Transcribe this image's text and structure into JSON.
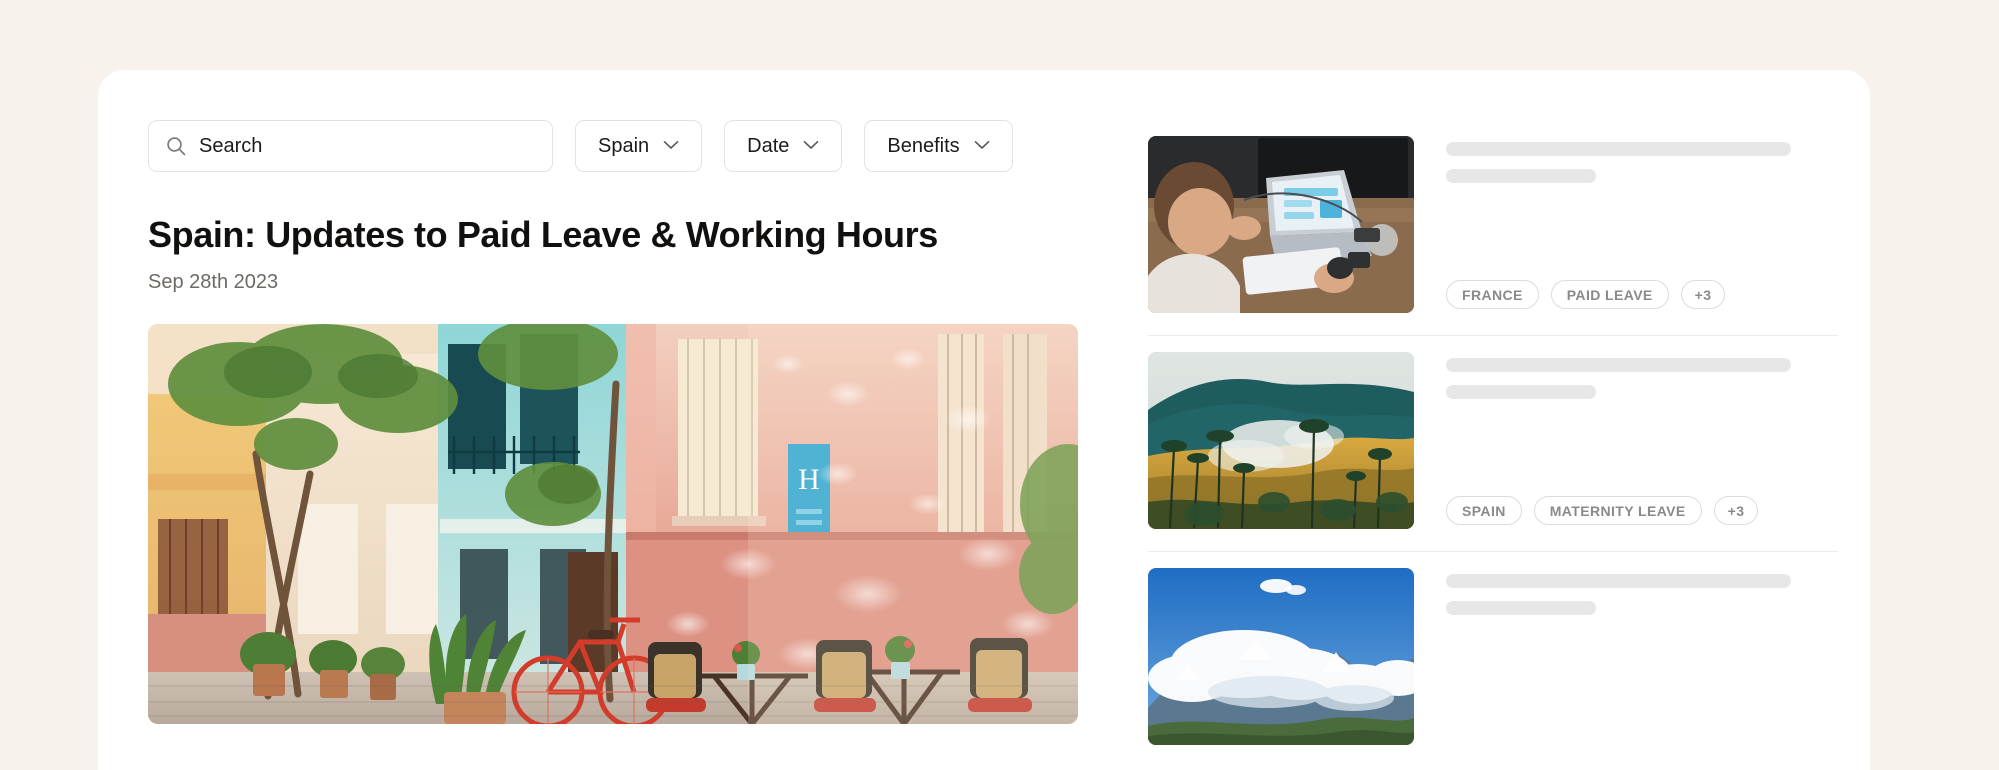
{
  "theme": {
    "page_background": "#f7f2ec",
    "card_background": "#ffffff",
    "border": "#e2e2e2",
    "text_primary": "#12100e",
    "text_muted": "#6d6a66",
    "skeleton": "#e7e7e7",
    "tag_text": "#8a8a8a",
    "divider": "#ececec"
  },
  "search": {
    "icon": "search-icon",
    "value": "",
    "placeholder": "Search"
  },
  "filters": [
    {
      "label": "Spain",
      "icon": "chevron-down-icon"
    },
    {
      "label": "Date",
      "icon": "chevron-down-icon"
    },
    {
      "label": "Benefits",
      "icon": "chevron-down-icon"
    }
  ],
  "article": {
    "title": "Spain: Updates to Paid Leave & Working Hours",
    "date": "Sep 28th 2023",
    "hero_image_alt": "Sunlit Spanish street with colorful yellow, teal and pink buildings, potted plants, a red bicycle and cafe tables with chairs"
  },
  "related": [
    {
      "thumbnail": "person-working-at-laptop-desk",
      "skeleton_lines": 2,
      "tags": [
        "FRANCE",
        "PAID LEAVE"
      ],
      "extra_tag_count": "+3"
    },
    {
      "thumbnail": "misty-green-mountain-valley-with-palms",
      "skeleton_lines": 2,
      "tags": [
        "SPAIN",
        "MATERNITY LEAVE"
      ],
      "extra_tag_count": "+3"
    },
    {
      "thumbnail": "snowy-mountains-under-blue-sky-with-clouds",
      "skeleton_lines": 2,
      "tags": [],
      "extra_tag_count": ""
    }
  ]
}
